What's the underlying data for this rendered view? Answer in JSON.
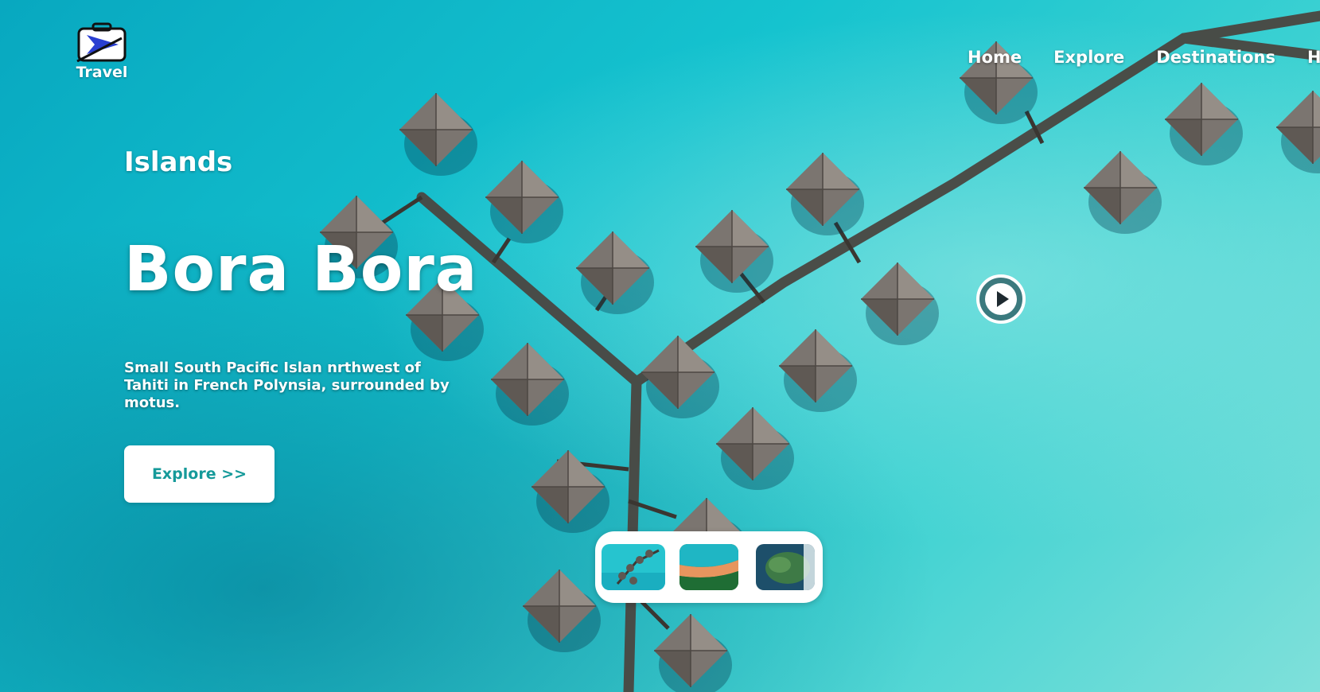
{
  "brand": {
    "name": "Travel",
    "icon": "suitcase-plane-icon"
  },
  "nav": {
    "items": [
      {
        "label": "Home"
      },
      {
        "label": "Explore"
      },
      {
        "label": "Destinations"
      },
      {
        "label": "Ho"
      }
    ]
  },
  "hero": {
    "category": "Islands",
    "title": "Bora Bora",
    "description": "Small South Pacific Islan nrthwest of Tahiti in French Polynsia, surrounded by motus.",
    "button_label": "Explore >>",
    "play_icon": "play-circle-icon"
  },
  "thumbnails": [
    {
      "icon": "overwater-bungalows-thumbnail"
    },
    {
      "icon": "beach-coast-thumbnail"
    },
    {
      "icon": "island-aerial-thumbnail"
    }
  ],
  "colors": {
    "accent": "#169a9a",
    "text": "#ffffff",
    "water": "#15c3cf"
  }
}
